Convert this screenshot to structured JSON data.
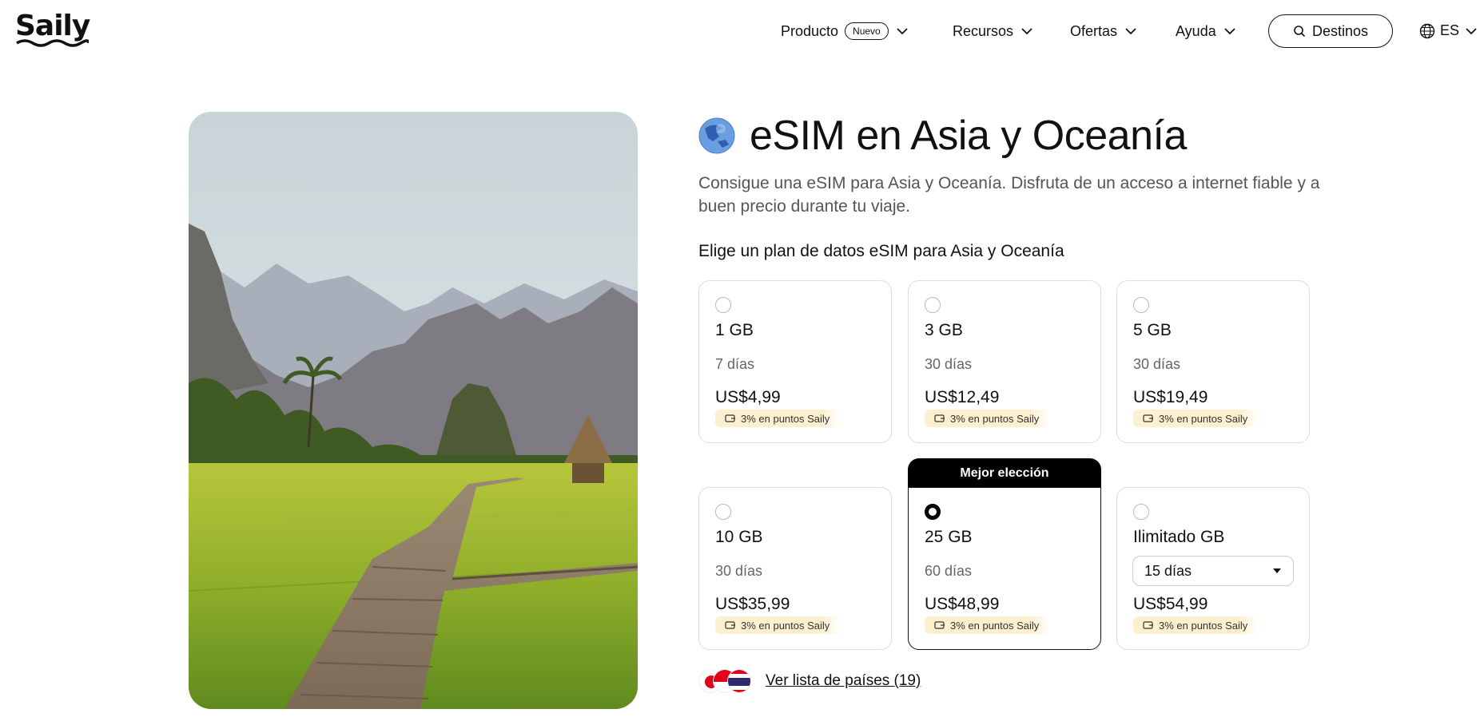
{
  "header": {
    "logo_text": "Saily",
    "nav": [
      {
        "label": "Producto",
        "badge": "Nuevo"
      },
      {
        "label": "Recursos"
      },
      {
        "label": "Ofertas"
      },
      {
        "label": "Ayuda"
      }
    ],
    "destinations_button": "Destinos",
    "language": "ES",
    "icons": [
      "chevron-down-icon",
      "search-icon",
      "globe-icon"
    ]
  },
  "main": {
    "title": "eSIM en Asia y Oceanía",
    "subtitle": "Consigue una eSIM para Asia y Oceanía. Disfruta de un acceso a internet fiable y a buen precio durante tu viaje.",
    "plans_heading": "Elige un plan de datos eSIM para Asia y Oceanía",
    "best_choice_label": "Mejor elección",
    "plans": [
      {
        "data": "1 GB",
        "duration": "7 días",
        "price": "US$4,99",
        "points": "3% en puntos Saily",
        "selected": false
      },
      {
        "data": "3 GB",
        "duration": "30 días",
        "price": "US$12,49",
        "points": "3% en puntos Saily",
        "selected": false
      },
      {
        "data": "5 GB",
        "duration": "30 días",
        "price": "US$19,49",
        "points": "3% en puntos Saily",
        "selected": false
      },
      {
        "data": "10 GB",
        "duration": "30 días",
        "price": "US$35,99",
        "points": "3% en puntos Saily",
        "selected": false
      },
      {
        "data": "25 GB",
        "duration": "60 días",
        "price": "US$48,99",
        "points": "3% en puntos Saily",
        "selected": true
      },
      {
        "data": "Ilimitado GB",
        "duration_select": "15 días",
        "price": "US$54,99",
        "points": "3% en puntos Saily",
        "selected": false
      }
    ],
    "countries_link": "Ver lista de países (19)"
  },
  "colors": {
    "text": "#111111",
    "muted": "#666666",
    "border": "#dcdcdc",
    "points_bg": "#fdf0cf",
    "best_tab": "#000000"
  }
}
